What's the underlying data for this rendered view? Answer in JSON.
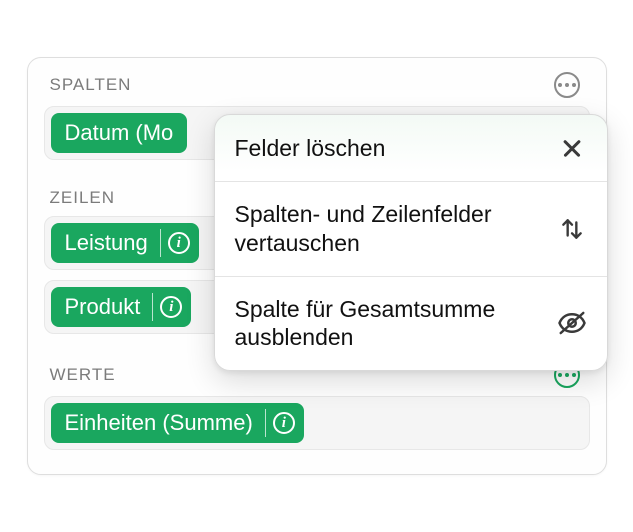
{
  "sections": {
    "columns": {
      "title": "SPALTEN",
      "fields": [
        {
          "label": "Datum (Mo"
        }
      ]
    },
    "rows": {
      "title": "ZEILEN",
      "fields": [
        {
          "label": "Leistung"
        },
        {
          "label": "Produkt"
        }
      ]
    },
    "values": {
      "title": "WERTE",
      "fields": [
        {
          "label": "Einheiten (Summe)"
        }
      ]
    }
  },
  "menu": {
    "delete": "Felder löschen",
    "swap": "Spalten- und Zeilenfelder vertauschen",
    "hide": "Spalte für Gesamtsum­me ausblenden"
  }
}
